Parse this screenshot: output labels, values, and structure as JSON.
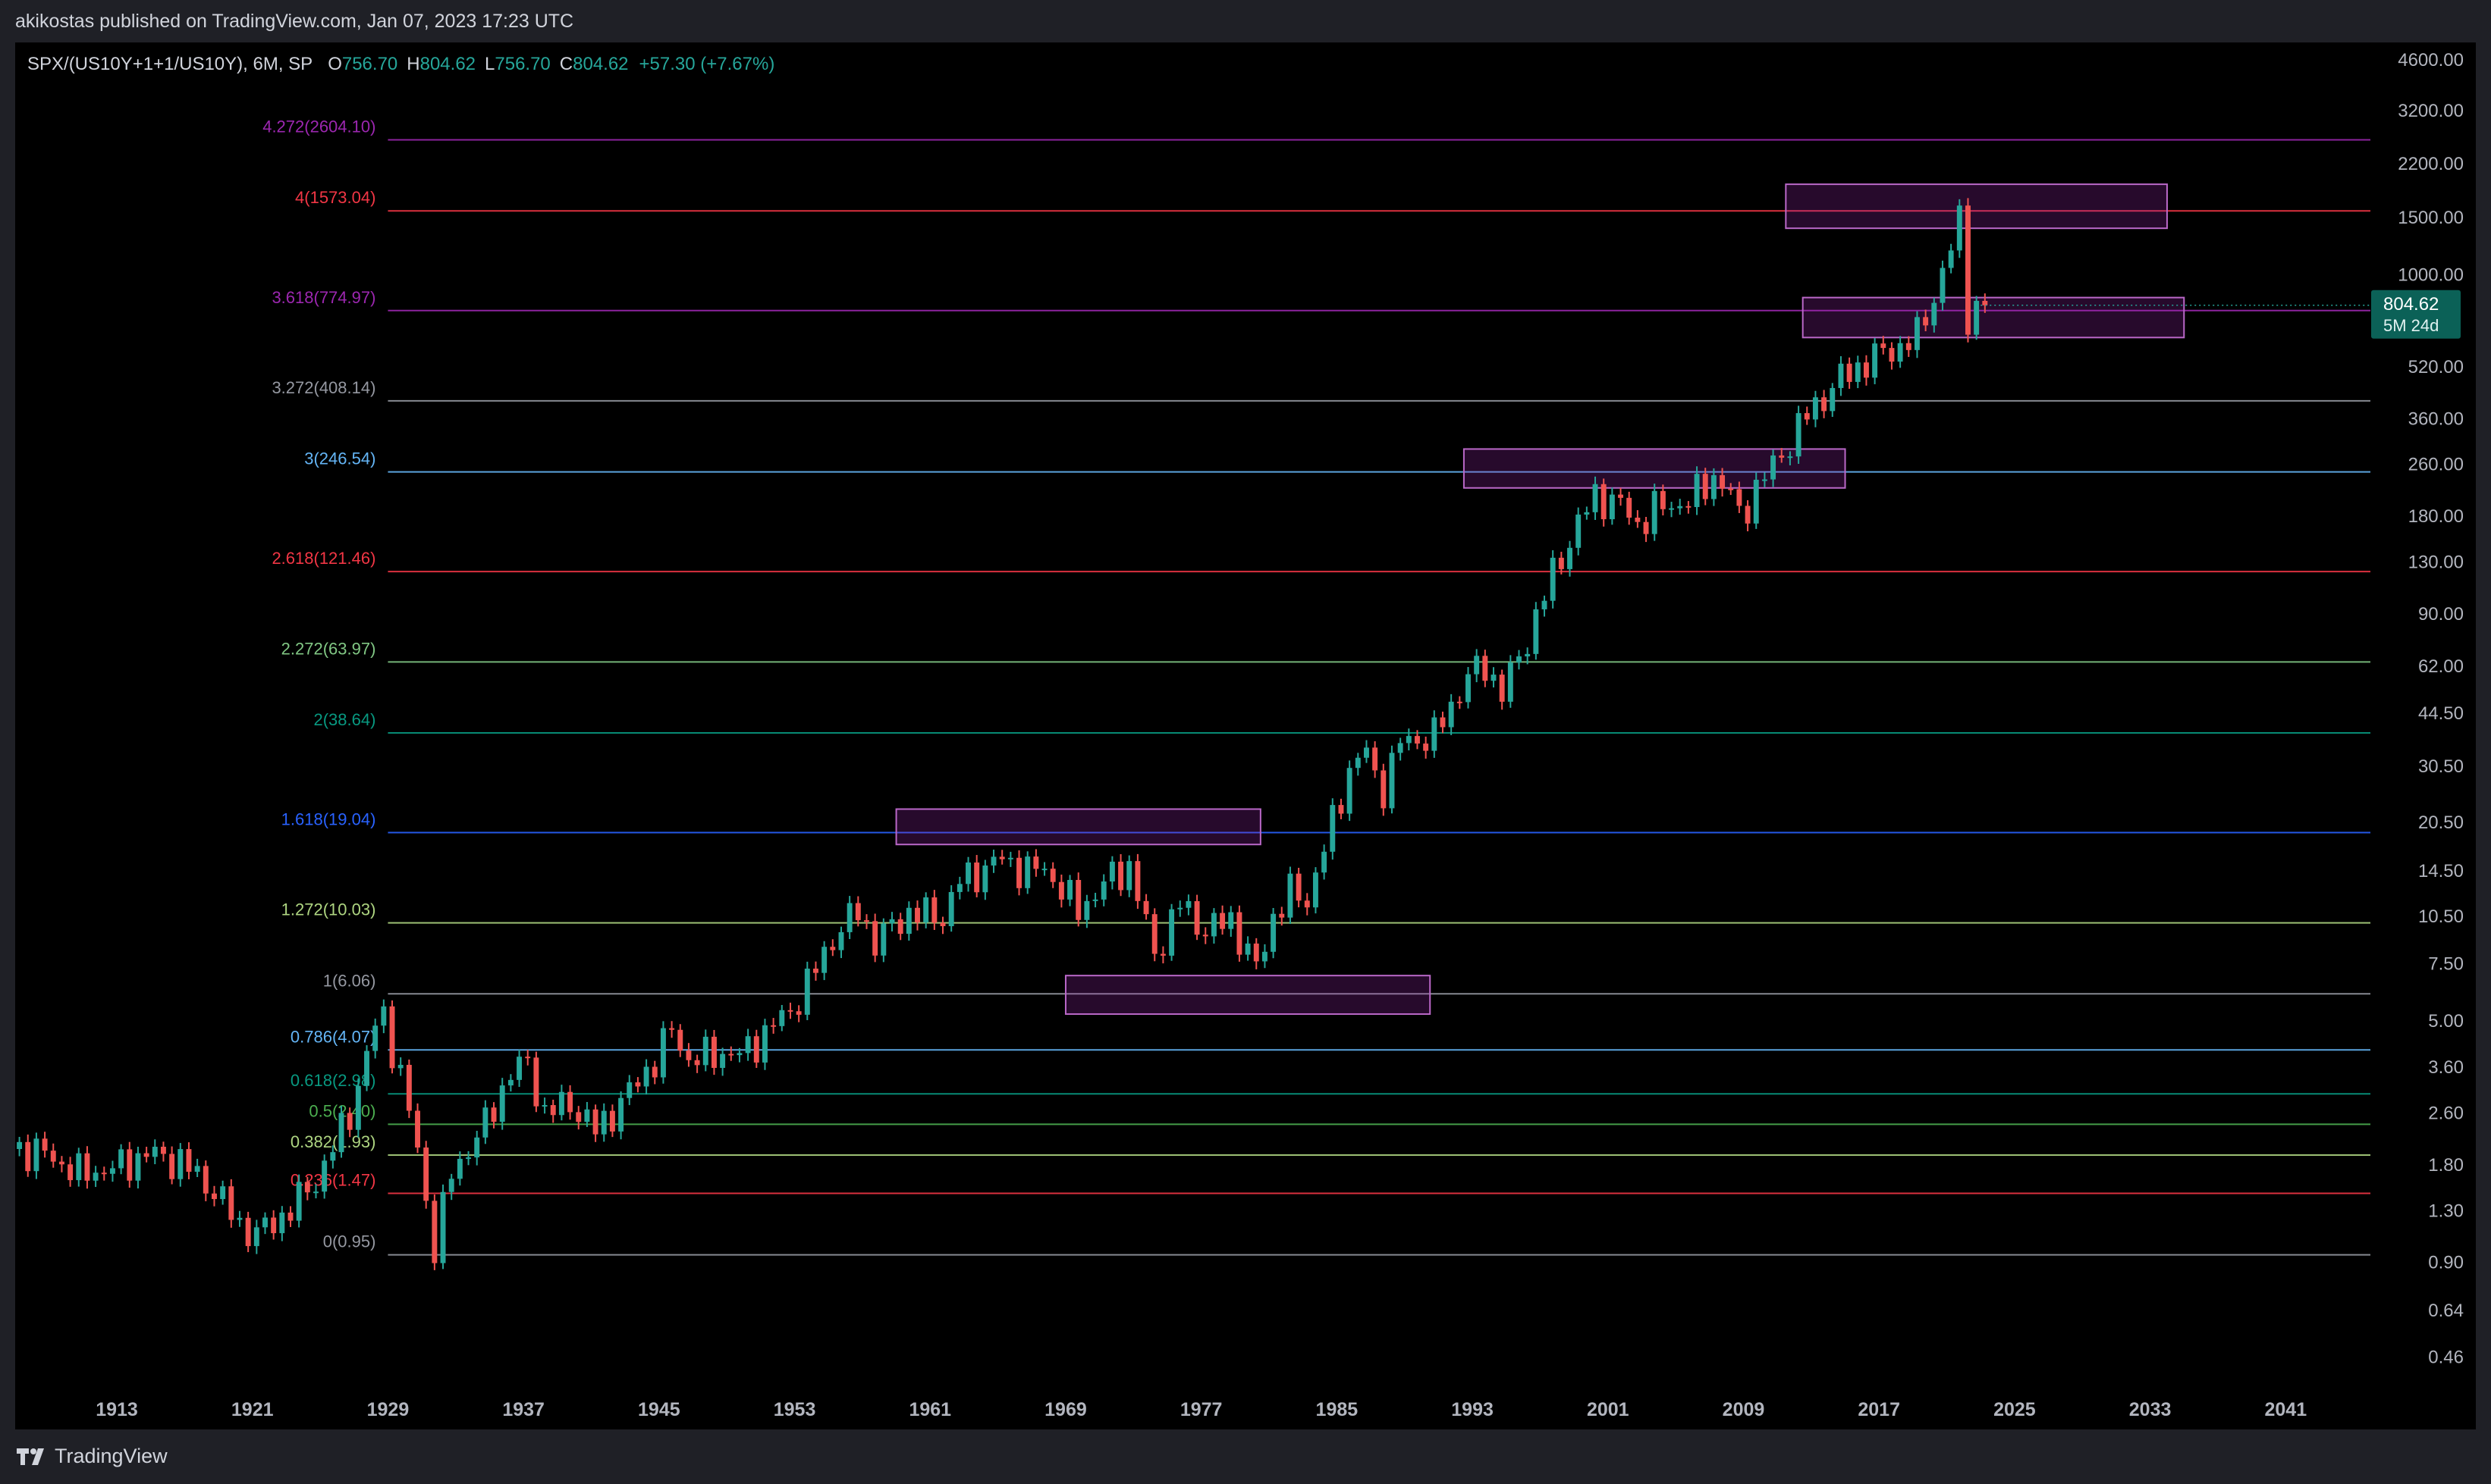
{
  "header": {
    "publish_info": "akikostas published on TradingView.com, Jan 07, 2023 17:23 UTC"
  },
  "footer": {
    "brand": "TradingView"
  },
  "colors": {
    "up": "#26a69a",
    "down": "#ef5350",
    "box_fill": "#9c27b0",
    "box_stroke": "#ba68c8",
    "axis_text": "#b2b5be"
  },
  "chart_data": {
    "type": "candlestick",
    "title": "",
    "symbol_line": {
      "symbol": "SPX/(US10Y+1+1/US10Y), 6M, SP",
      "o_label": "O",
      "o_value": "756.70",
      "h_label": "H",
      "h_value": "804.62",
      "l_label": "L",
      "l_value": "756.70",
      "c_label": "C",
      "c_value": "804.62",
      "change": "+57.30 (+7.67%)"
    },
    "y_scale": "log",
    "ylim": [
      0.36,
      5200
    ],
    "xlim": [
      1907,
      2046
    ],
    "x_ticks": [
      "1913",
      "1921",
      "1929",
      "1937",
      "1945",
      "1953",
      "1961",
      "1969",
      "1977",
      "1985",
      "1993",
      "2001",
      "2009",
      "2017",
      "2025",
      "2033",
      "2041"
    ],
    "y_ticks": [
      "4600.00",
      "3200.00",
      "2200.00",
      "1500.00",
      "1000.00",
      "520.00",
      "360.00",
      "260.00",
      "180.00",
      "130.00",
      "90.00",
      "62.00",
      "44.50",
      "30.50",
      "20.50",
      "14.50",
      "10.50",
      "7.50",
      "5.00",
      "3.60",
      "2.60",
      "1.80",
      "1.30",
      "0.90",
      "0.64",
      "0.46"
    ],
    "last_price": {
      "value": 804.62,
      "label": "804.62",
      "countdown": "5M 24d"
    },
    "fib_start_x": 1929.0,
    "fib_levels": [
      {
        "label": "4.272(2604.10)",
        "value": 2604.1,
        "color": "#9c27b0"
      },
      {
        "label": "4(1573.04)",
        "value": 1573.04,
        "color": "#f23645"
      },
      {
        "label": "3.618(774.97)",
        "value": 774.97,
        "color": "#9c27b0"
      },
      {
        "label": "3.272(408.14)",
        "value": 408.14,
        "color": "#9598a1"
      },
      {
        "label": "3(246.54)",
        "value": 246.54,
        "color": "#64b5f6"
      },
      {
        "label": "2.618(121.46)",
        "value": 121.46,
        "color": "#f23645"
      },
      {
        "label": "2.272(63.97)",
        "value": 63.97,
        "color": "#81c784"
      },
      {
        "label": "2(38.64)",
        "value": 38.64,
        "color": "#089981"
      },
      {
        "label": "1.618(19.04)",
        "value": 19.04,
        "color": "#2962ff"
      },
      {
        "label": "1.272(10.03)",
        "value": 10.03,
        "color": "#aed581"
      },
      {
        "label": "1(6.06)",
        "value": 6.06,
        "color": "#9598a1"
      },
      {
        "label": "0.786(4.07)",
        "value": 4.07,
        "color": "#64b5f6"
      },
      {
        "label": "0.618(2.98)",
        "value": 2.98,
        "color": "#089981"
      },
      {
        "label": "0.5(2.40)",
        "value": 2.4,
        "color": "#4caf50"
      },
      {
        "label": "0.382(1.93)",
        "value": 1.93,
        "color": "#aed581"
      },
      {
        "label": "0.236(1.47)",
        "value": 1.47,
        "color": "#f23645"
      },
      {
        "label": "0(0.95)",
        "value": 0.95,
        "color": "#9598a1"
      }
    ],
    "boxes": [
      {
        "x0": 2011.5,
        "x1": 2034.0,
        "y_low": 1390,
        "y_high": 1900
      },
      {
        "x0": 2012.5,
        "x1": 2035.0,
        "y_low": 640,
        "y_high": 850
      },
      {
        "x0": 1992.5,
        "x1": 2015.0,
        "y_low": 220,
        "y_high": 290
      },
      {
        "x0": 1959.0,
        "x1": 1980.5,
        "y_low": 17.5,
        "y_high": 22.5
      },
      {
        "x0": 1969.0,
        "x1": 1990.5,
        "y_low": 5.25,
        "y_high": 6.9
      }
    ],
    "anchors": [
      [
        1907.0,
        2.05
      ],
      [
        1909.0,
        1.95
      ],
      [
        1911.0,
        1.7
      ],
      [
        1913.0,
        1.75
      ],
      [
        1915.0,
        1.95
      ],
      [
        1917.0,
        1.85
      ],
      [
        1919.0,
        1.5
      ],
      [
        1920.5,
        1.18
      ],
      [
        1921.5,
        1.1
      ],
      [
        1923.0,
        1.25
      ],
      [
        1925.0,
        1.6
      ],
      [
        1927.0,
        2.6
      ],
      [
        1928.5,
        4.8
      ],
      [
        1929.0,
        5.2
      ],
      [
        1930.0,
        3.4
      ],
      [
        1931.0,
        2.0
      ],
      [
        1932.0,
        1.0
      ],
      [
        1933.0,
        1.7
      ],
      [
        1935.0,
        2.4
      ],
      [
        1936.5,
        3.5
      ],
      [
        1937.5,
        3.7
      ],
      [
        1938.5,
        2.6
      ],
      [
        1940.0,
        2.8
      ],
      [
        1941.5,
        2.3
      ],
      [
        1943.0,
        2.8
      ],
      [
        1945.0,
        3.8
      ],
      [
        1946.0,
        4.7
      ],
      [
        1947.0,
        3.8
      ],
      [
        1949.0,
        4.0
      ],
      [
        1950.0,
        3.9
      ],
      [
        1951.5,
        4.6
      ],
      [
        1953.0,
        5.4
      ],
      [
        1954.0,
        6.5
      ],
      [
        1955.5,
        9.0
      ],
      [
        1957.0,
        11.0
      ],
      [
        1958.0,
        8.8
      ],
      [
        1960.0,
        10.8
      ],
      [
        1962.0,
        10.5
      ],
      [
        1963.0,
        13.5
      ],
      [
        1965.5,
        15.8
      ],
      [
        1967.0,
        14.5
      ],
      [
        1968.0,
        14.8
      ],
      [
        1970.0,
        11.0
      ],
      [
        1972.0,
        14.0
      ],
      [
        1973.0,
        15.0
      ],
      [
        1974.5,
        8.0
      ],
      [
        1976.0,
        11.5
      ],
      [
        1977.5,
        9.5
      ],
      [
        1979.0,
        10.3
      ],
      [
        1980.5,
        7.2
      ],
      [
        1981.5,
        10.5
      ],
      [
        1982.5,
        12.5
      ],
      [
        1983.5,
        11.8
      ],
      [
        1985.0,
        20.5
      ],
      [
        1986.0,
        30.0
      ],
      [
        1987.0,
        34.0
      ],
      [
        1987.8,
        25.0
      ],
      [
        1989.0,
        36.0
      ],
      [
        1991.0,
        38.0
      ],
      [
        1993.0,
        58.0
      ],
      [
        1994.0,
        62.0
      ],
      [
        1995.0,
        52.0
      ],
      [
        1996.0,
        65.0
      ],
      [
        1998.0,
        120.0
      ],
      [
        1999.5,
        170.0
      ],
      [
        2000.5,
        210.0
      ],
      [
        2002.0,
        195.0
      ],
      [
        2003.0,
        170.0
      ],
      [
        2004.0,
        190.0
      ],
      [
        2006.0,
        200.0
      ],
      [
        2007.5,
        240.0
      ],
      [
        2008.5,
        210.0
      ],
      [
        2009.0,
        180.0
      ],
      [
        2010.0,
        220.0
      ],
      [
        2011.5,
        280.0
      ],
      [
        2013.0,
        370.0
      ],
      [
        2015.0,
        480.0
      ],
      [
        2017.0,
        560.0
      ],
      [
        2018.5,
        600.0
      ],
      [
        2019.5,
        650.0
      ],
      [
        2020.5,
        860.0
      ],
      [
        2021.5,
        1200.0
      ],
      [
        2022.0,
        1480.0
      ],
      [
        2022.5,
        760.0
      ],
      [
        2023.0,
        805.0
      ]
    ]
  }
}
